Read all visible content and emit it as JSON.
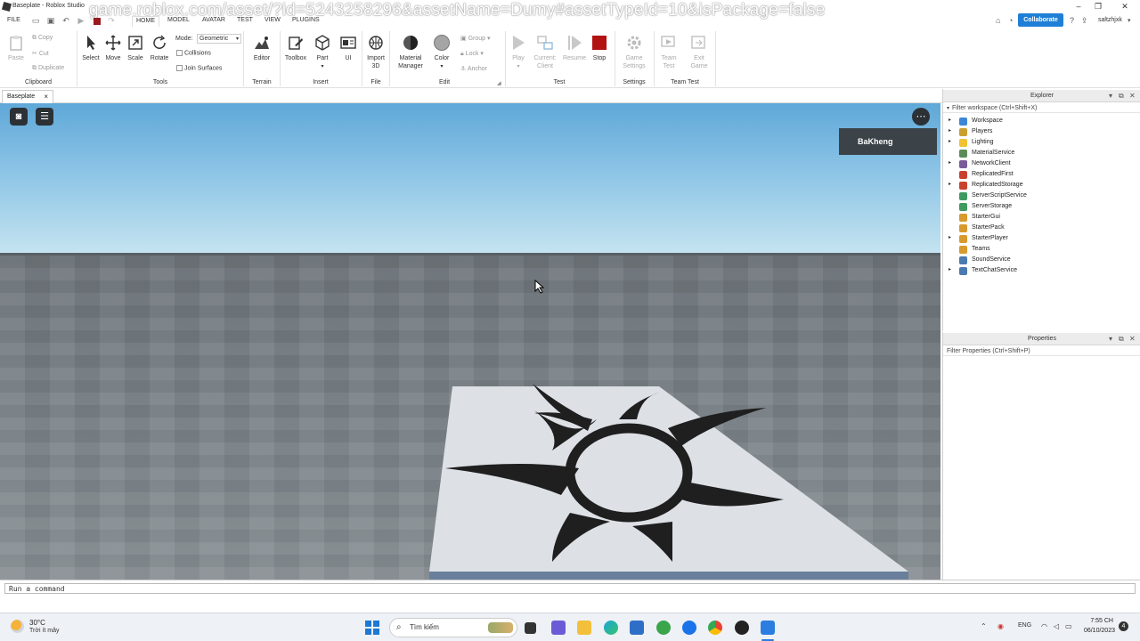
{
  "app": {
    "title": "Baseplate - Roblox Studio",
    "url_overlay": "game.roblox.com/asset/?id=5243258296&assetName=Dumy#assetTypeId=10&isPackage=false",
    "user": "saltzhjxk",
    "collaborate_label": "Collaborate"
  },
  "menu": {
    "file": "FILE",
    "tabs": [
      "HOME",
      "MODEL",
      "AVATAR",
      "TEST",
      "VIEW",
      "PLUGINS"
    ]
  },
  "ribbon": {
    "clipboard": {
      "paste": "Paste",
      "copy": "Copy",
      "cut": "Cut",
      "duplicate": "Duplicate",
      "group_label": "Clipboard"
    },
    "tools": {
      "select": "Select",
      "move": "Move",
      "scale": "Scale",
      "rotate": "Rotate",
      "mode_label": "Mode:",
      "mode_value": "Geometric",
      "collisions": "Collisions",
      "join_surfaces": "Join Surfaces",
      "group_label": "Tools"
    },
    "terrain": {
      "editor": "Editor",
      "group_label": "Terrain"
    },
    "insert": {
      "toolbox": "Toolbox",
      "part": "Part",
      "ui": "UI",
      "group_label": "Insert"
    },
    "file": {
      "import3d_1": "Import",
      "import3d_2": "3D",
      "group_label": "File"
    },
    "edit": {
      "material_1": "Material",
      "material_2": "Manager",
      "color": "Color",
      "group": "Group",
      "lock": "Lock",
      "anchor": "Anchor",
      "group_label": "Edit"
    },
    "test": {
      "play": "Play",
      "current_1": "Current:",
      "current_2": "Client",
      "resume": "Resume",
      "stop": "Stop",
      "group_label": "Test"
    },
    "settings": {
      "game_1": "Game",
      "game_2": "Settings",
      "group_label": "Settings"
    },
    "team_test": {
      "team_1": "Team",
      "team_2": "Test",
      "exit_1": "Exit",
      "exit_2": "Game",
      "group_label": "Team Test"
    }
  },
  "document_tab": {
    "label": "Baseplate",
    "close": "×"
  },
  "viewport": {
    "player_name": "BaKheng"
  },
  "explorer": {
    "title": "Explorer",
    "filter": "Filter workspace (Ctrl+Shift+X)",
    "items": [
      {
        "label": "Workspace",
        "expand": "▸",
        "color": "#3b86d6"
      },
      {
        "label": "Players",
        "expand": "▸",
        "color": "#c99f2d"
      },
      {
        "label": "Lighting",
        "expand": "▸",
        "color": "#f0c232"
      },
      {
        "label": "MaterialService",
        "expand": "",
        "color": "#5a8c5a"
      },
      {
        "label": "NetworkClient",
        "expand": "▸",
        "color": "#7a5a9a"
      },
      {
        "label": "ReplicatedFirst",
        "expand": "",
        "color": "#c9412d"
      },
      {
        "label": "ReplicatedStorage",
        "expand": "▸",
        "color": "#c9412d"
      },
      {
        "label": "ServerScriptService",
        "expand": "",
        "color": "#3e9a5e"
      },
      {
        "label": "ServerStorage",
        "expand": "",
        "color": "#3e9a5e"
      },
      {
        "label": "StarterGui",
        "expand": "",
        "color": "#d89a2d"
      },
      {
        "label": "StarterPack",
        "expand": "",
        "color": "#d89a2d"
      },
      {
        "label": "StarterPlayer",
        "expand": "▸",
        "color": "#d89a2d"
      },
      {
        "label": "Teams",
        "expand": "",
        "color": "#d89a2d"
      },
      {
        "label": "SoundService",
        "expand": "",
        "color": "#4a7ab0"
      },
      {
        "label": "TextChatService",
        "expand": "▸",
        "color": "#4a7ab0"
      }
    ]
  },
  "properties": {
    "title": "Properties",
    "filter": "Filter Properties (Ctrl+Shift+P)"
  },
  "command_bar": {
    "placeholder": "Run a command"
  },
  "taskbar": {
    "weather_temp": "30°C",
    "weather_desc": "Trời ít mây",
    "search_placeholder": "Tìm kiếm",
    "lang": "ENG",
    "time": "7:55 CH",
    "date": "06/10/2023",
    "notifications": "4"
  }
}
